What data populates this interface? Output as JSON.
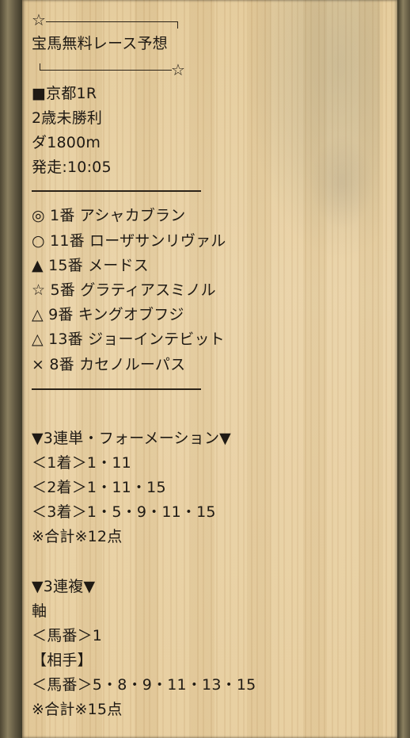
{
  "title": {
    "star_left": "☆",
    "text": "宝馬無料レース予想",
    "star_right": "☆"
  },
  "race": {
    "venue": "■京都1R",
    "class": "2歳未勝利",
    "course": "ダ1800m",
    "start": "発走:10:05"
  },
  "picks": [
    {
      "mark": "◎",
      "text": "1番 アシャカブラン"
    },
    {
      "mark": "○",
      "text": "11番 ローザサンリヴァル"
    },
    {
      "mark": "▲",
      "text": "15番 メードス"
    },
    {
      "mark": "☆",
      "text": "5番 グラティアスミノル"
    },
    {
      "mark": "△",
      "text": "9番 キングオブフジ"
    },
    {
      "mark": "△",
      "text": "13番 ジョーインテビット"
    },
    {
      "mark": "×",
      "text": "8番 カセノルーパス"
    }
  ],
  "trifecta": {
    "heading": "▼3連単・フォーメーション▼",
    "first": "＜1着＞1・11",
    "second": "＜2着＞1・11・15",
    "third": "＜3着＞1・5・9・11・15",
    "total": "※合計※12点"
  },
  "trio": {
    "heading": "▼3連複▼",
    "axis_label": "軸",
    "axis": "＜馬番＞1",
    "partner_label": "【相手】",
    "partners": "＜馬番＞5・8・9・11・13・15",
    "total": "※合計※15点"
  }
}
